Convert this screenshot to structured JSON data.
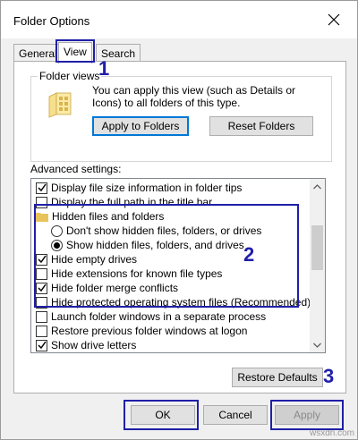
{
  "window": {
    "title": "Folder Options"
  },
  "tabs": [
    {
      "label": "General",
      "active": false
    },
    {
      "label": "View",
      "active": true
    },
    {
      "label": "Search",
      "active": false
    }
  ],
  "folder_views": {
    "legend": "Folder views",
    "description": "You can apply this view (such as Details or Icons) to all folders of this type.",
    "apply_button": "Apply to Folders",
    "reset_button": "Reset Folders"
  },
  "advanced": {
    "label": "Advanced settings:",
    "items": [
      {
        "type": "checkbox",
        "checked": true,
        "label": "Display file size information in folder tips"
      },
      {
        "type": "checkbox",
        "checked": false,
        "label": "Display the full path in the title bar"
      },
      {
        "type": "folder",
        "label": "Hidden files and folders"
      },
      {
        "type": "radio",
        "checked": false,
        "label": "Don't show hidden files, folders, or drives"
      },
      {
        "type": "radio",
        "checked": true,
        "label": "Show hidden files, folders, and drives"
      },
      {
        "type": "checkbox",
        "checked": true,
        "label": "Hide empty drives"
      },
      {
        "type": "checkbox",
        "checked": false,
        "label": "Hide extensions for known file types"
      },
      {
        "type": "checkbox",
        "checked": true,
        "label": "Hide folder merge conflicts"
      },
      {
        "type": "checkbox",
        "checked": false,
        "label": "Hide protected operating system files (Recommended)"
      },
      {
        "type": "checkbox",
        "checked": false,
        "label": "Launch folder windows in a separate process"
      },
      {
        "type": "checkbox",
        "checked": false,
        "label": "Restore previous folder windows at logon"
      },
      {
        "type": "checkbox",
        "checked": true,
        "label": "Show drive letters"
      }
    ]
  },
  "buttons": {
    "restore_defaults": "Restore Defaults",
    "ok": "OK",
    "cancel": "Cancel",
    "apply": "Apply"
  },
  "annotations": {
    "marker_1": "1",
    "marker_2": "2",
    "marker_3": "3"
  },
  "watermark": "wsxdn.com",
  "colors": {
    "annotation": "#1f1fa8",
    "default_button_border": "#0078d7",
    "folder_yellow": "#e8c35a"
  }
}
